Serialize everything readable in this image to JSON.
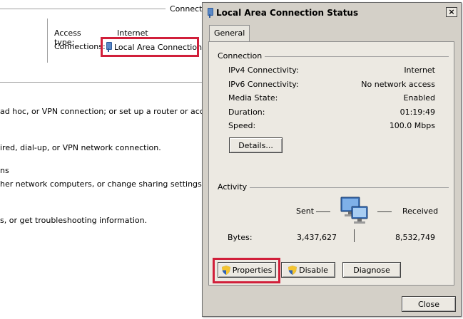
{
  "background": {
    "header_label": "Connect",
    "access_type_label": "Access type:",
    "access_type_value": "Internet",
    "connections_label": "Connections:",
    "connections_value": "Local Area Connection",
    "lines": [
      " ad hoc, or VPN connection; or set up a router or access p",
      "ired, dial-up, or VPN network connection.",
      "ns",
      "her network computers, or change sharing settings.",
      "s, or get troubleshooting information."
    ]
  },
  "dialog": {
    "title": "Local Area Connection Status",
    "close_glyph": "×",
    "tab_general": "General",
    "connection": {
      "group_label": "Connection",
      "rows": [
        {
          "label": "IPv4 Connectivity:",
          "value": "Internet"
        },
        {
          "label": "IPv6 Connectivity:",
          "value": "No network access"
        },
        {
          "label": "Media State:",
          "value": "Enabled"
        },
        {
          "label": "Duration:",
          "value": "01:19:49"
        },
        {
          "label": "Speed:",
          "value": "100.0 Mbps"
        }
      ],
      "details_button": "Details..."
    },
    "activity": {
      "group_label": "Activity",
      "sent_label": "Sent",
      "received_label": "Received",
      "bytes_label": "Bytes:",
      "bytes_sent": "3,437,627",
      "bytes_received": "8,532,749"
    },
    "buttons": {
      "properties": "Properties",
      "disable": "Disable",
      "diagnose": "Diagnose",
      "close": "Close"
    },
    "icons": {
      "title_icon": "network-adapter-icon",
      "shield_icon": "uac-shield-icon",
      "activity_icon": "network-computers-icon"
    },
    "colors": {
      "highlight": "#d11f3a",
      "dialog_bg": "#d4d0c8",
      "panel_bg": "#ece9e2"
    }
  }
}
